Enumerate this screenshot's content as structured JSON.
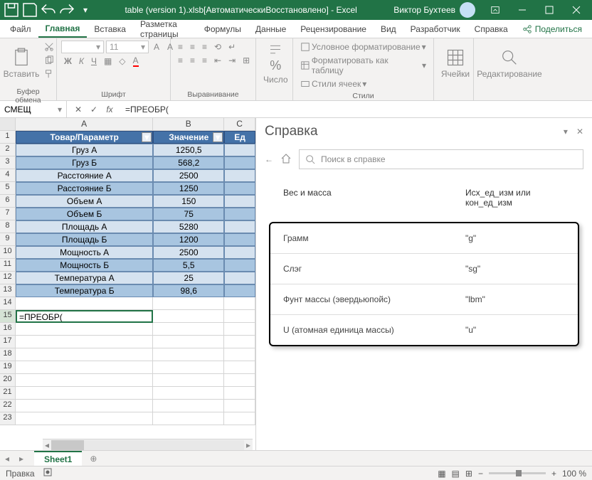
{
  "titlebar": {
    "filename": "table (version 1).xlsb[АвтоматическиВосстановлено] - Excel",
    "user": "Виктор Бухтеев"
  },
  "tabs": {
    "file": "Файл",
    "home": "Главная",
    "insert": "Вставка",
    "pagelayout": "Разметка страницы",
    "formulas": "Формулы",
    "data": "Данные",
    "review": "Рецензирование",
    "view": "Вид",
    "developer": "Разработчик",
    "help": "Справка",
    "share": "Поделиться"
  },
  "ribbon": {
    "clipboard": {
      "label": "Буфер обмена",
      "paste": "Вставить"
    },
    "font": {
      "label": "Шрифт",
      "size": "11"
    },
    "alignment": {
      "label": "Выравнивание"
    },
    "number": {
      "label": "Число",
      "btn": "Число"
    },
    "styles": {
      "label": "Стили",
      "cond": "Условное форматирование",
      "table": "Форматировать как таблицу",
      "cell": "Стили ячеек"
    },
    "cells": {
      "label": "Ячейки",
      "btn": "Ячейки"
    },
    "editing": {
      "label": "Редактирование",
      "btn": "Редактирование"
    }
  },
  "namebox": "СМЕЩ",
  "formula": "=ПРЕОБР(",
  "columns": {
    "a": "A",
    "b": "B",
    "c": "C"
  },
  "table_headers": {
    "a": "Товар/Параметр",
    "b": "Значение",
    "c": "Ед"
  },
  "rows": [
    {
      "a": "Груз А",
      "b": "1250,5"
    },
    {
      "a": "Груз Б",
      "b": "568,2"
    },
    {
      "a": "Расстояние А",
      "b": "2500"
    },
    {
      "a": "Расстояние Б",
      "b": "1250"
    },
    {
      "a": "Объем А",
      "b": "150"
    },
    {
      "a": "Объем Б",
      "b": "75"
    },
    {
      "a": "Площадь А",
      "b": "5280"
    },
    {
      "a": "Площадь Б",
      "b": "1200"
    },
    {
      "a": "Мощность А",
      "b": "2500"
    },
    {
      "a": "Мощность Б",
      "b": "5,5"
    },
    {
      "a": "Температура А",
      "b": "25"
    },
    {
      "a": "Температура Б",
      "b": "98,6"
    }
  ],
  "active_cell_text": "=ПРЕОБР(",
  "help": {
    "title": "Справка",
    "search_ph": "Поиск в справке",
    "col1": "Вес и масса",
    "col2": "Исх_ед_изм или кон_ед_изм",
    "items": [
      {
        "n": "Грамм",
        "u": "\"g\""
      },
      {
        "n": "Слэг",
        "u": "\"sg\""
      },
      {
        "n": "Фунт массы (эвердьюпойс)",
        "u": "\"lbm\""
      },
      {
        "n": "U (атомная единица массы)",
        "u": "\"u\""
      }
    ]
  },
  "sheet": "Sheet1",
  "status": {
    "mode": "Правка",
    "zoom": "100 %"
  }
}
